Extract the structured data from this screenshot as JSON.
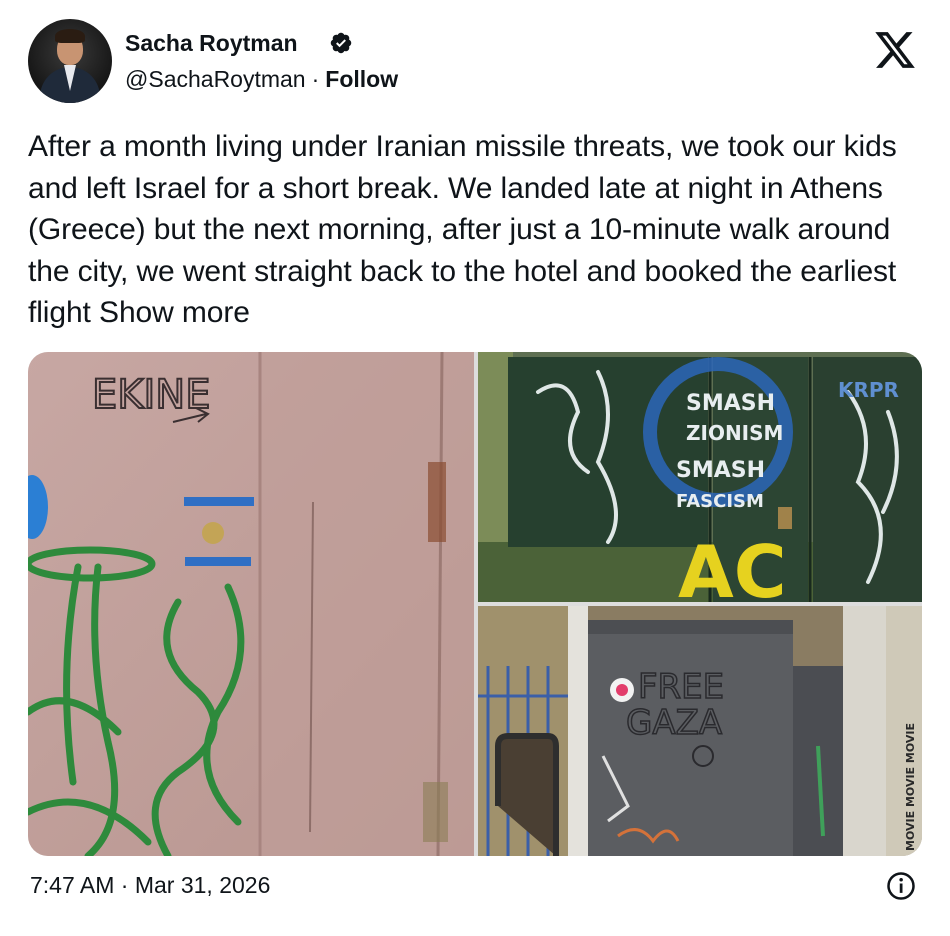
{
  "author": {
    "name": "Sacha Roytman",
    "handle": "@SachaRoytman",
    "separator": "·",
    "follow_label": "Follow",
    "verified_icon": "verified-badge-icon"
  },
  "brand_icon": "x-logo-icon",
  "tweet": {
    "text": "After a month living under Iranian missile threats, we took our kids and left Israel for a short break. We landed late at night in Athens (Greece) but the next morning, after just a 10-minute walk around the city, we went straight back to the hotel and booked the earliest flight",
    "show_more_label": "Show more"
  },
  "media": {
    "left": {
      "graffiti_text": "EKINE"
    },
    "top_right": {
      "graffiti_lines": [
        "SMASH",
        "ZIONISM",
        "SMASH",
        "FASCISM"
      ],
      "yellow_tag": "AC"
    },
    "bottom_right": {
      "graffiti_lines": [
        "FREE",
        "GAZA"
      ],
      "side_text": "MOVIE MOVIE MOVIE"
    }
  },
  "footer": {
    "timestamp": "7:47 AM · Mar 31, 2026",
    "info_icon": "info-icon"
  }
}
